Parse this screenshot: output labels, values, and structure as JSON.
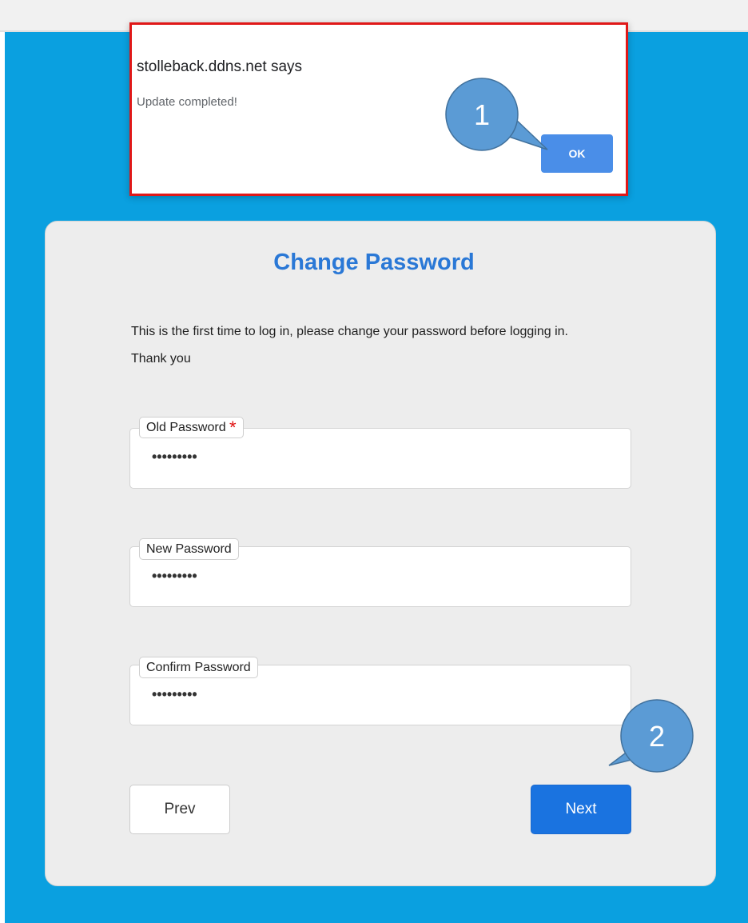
{
  "dialog": {
    "host_text": "stolleback.ddns.net says",
    "message": "Update completed!",
    "ok_label": "OK"
  },
  "form": {
    "title": "Change Password",
    "intro_line1": "This is the first time to log in, please change your password before logging in.",
    "intro_line2": "Thank you",
    "fields": [
      {
        "label": "Old Password",
        "required_mark": "*",
        "value": "•••••••••"
      },
      {
        "label": "New Password",
        "value": "•••••••••"
      },
      {
        "label": "Confirm Password",
        "value": "•••••••••"
      }
    ],
    "prev_label": "Prev",
    "next_label": "Next"
  },
  "annotations": {
    "step1": "1",
    "step2": "2",
    "highlight_color": "#e01818",
    "callout_color": "#5b9bd5"
  }
}
